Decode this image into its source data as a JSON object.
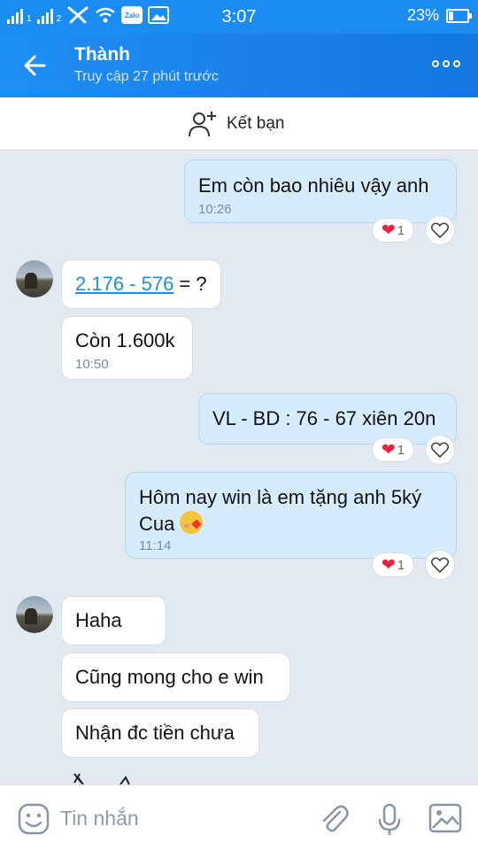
{
  "status_bar": {
    "time": "3:07",
    "battery_percent": "23%",
    "battery_level": 0.23,
    "zalo_badge": "Zalo"
  },
  "header": {
    "contact_name": "Thành",
    "contact_status": "Truy cập 27 phút trước"
  },
  "add_friend_label": "Kết bạn",
  "messages": [
    {
      "direction": "out",
      "text": "Em còn bao nhiêu vậy anh",
      "time": "10:26",
      "reaction_count": "1"
    },
    {
      "direction": "in",
      "link": "2.176 - 576",
      "text": " = ?"
    },
    {
      "direction": "in",
      "text": "Còn 1.600k",
      "time": "10:50"
    },
    {
      "direction": "out",
      "text": "VL - BD : 76 - 67 xiên 20n",
      "reaction_count": "1"
    },
    {
      "direction": "out",
      "text_line1": "Hôm nay win là em tặng anh 5ký",
      "text_line2": "Cua",
      "time": "11:14",
      "reaction_count": "1"
    },
    {
      "direction": "in",
      "text": "Haha"
    },
    {
      "direction": "in",
      "text": "Cũng mong cho e win"
    },
    {
      "direction": "in",
      "text": "Nhận đc tiền chưa"
    }
  ],
  "input": {
    "placeholder": "Tin nhắn"
  },
  "colors": {
    "header_blue": "#1a8cf4",
    "outgoing_bubble": "#d5ecfd",
    "chat_background": "#e2e9f1",
    "heart_red": "#e8233b",
    "link_blue": "#1b8ee8"
  },
  "icons": [
    "back-arrow-icon",
    "more-options-icon",
    "add-friend-icon",
    "heart-icon",
    "like-heart-icon",
    "sticker-icon",
    "attach-icon",
    "microphone-icon",
    "image-icon",
    "flushed-emoji-icon"
  ]
}
